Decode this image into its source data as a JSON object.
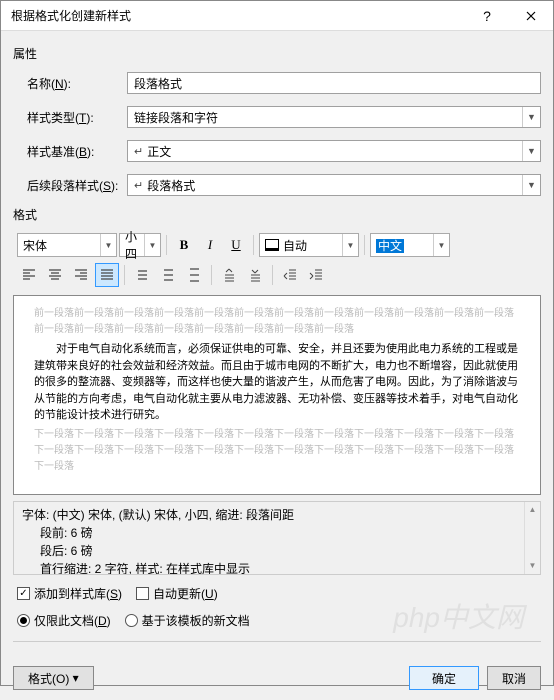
{
  "title": "根据格式化创建新样式",
  "properties_label": "属性",
  "fields": {
    "name_label": "名称(N):",
    "name_value": "段落格式",
    "type_label": "样式类型(T):",
    "type_value": "链接段落和字符",
    "based_label": "样式基准(B):",
    "based_value": "正文",
    "following_label": "后续段落样式(S):",
    "following_value": "段落格式"
  },
  "format_label": "格式",
  "toolbar": {
    "font": "宋体",
    "size": "小四",
    "bold": "B",
    "italic": "I",
    "underline": "U",
    "color": "自动",
    "lang": "中文"
  },
  "preview": {
    "before": "前一段落前一段落前一段落前一段落前一段落前一段落前一段落前一段落前一段落前一段落前一段落前一段落前一段落前一段落前一段落前一段落前一段落前一段落前一段落前一段落",
    "sample": "对于电气自动化系统而言，必须保证供电的可靠、安全，并且还要为使用此电力系统的工程或是建筑带来良好的社会效益和经济效益。而且由于城市电网的不断扩大，电力也不断增容，因此就使用的很多的整流器、变频器等，而这样也使大量的谐波产生，从而危害了电网。因此，为了消除谐波与从节能的方向考虑，电气自动化就主要从电力滤波器、无功补偿、变压器等技术着手，对电气自动化的节能设计技术进行研究。",
    "after": "下一段落下一段落下一段落下一段落下一段落下一段落下一段落下一段落下一段落下一段落下一段落下一段落下一段落下一段落下一段落下一段落下一段落下一段落下一段落下一段落下一段落下一段落下一段落下一段落下一段落"
  },
  "description": {
    "line1": "字体: (中文) 宋体, (默认) 宋体, 小四, 缩进: 段落间距",
    "line2": "段前: 6 磅",
    "line3": "段后: 6 磅",
    "line4": "首行缩进:  2 字符, 样式: 在样式库中显示"
  },
  "checks": {
    "add_gallery": "添加到样式库(S)",
    "auto_update": "自动更新(U)"
  },
  "radios": {
    "this_doc": "仅限此文档(D)",
    "template": "基于该模板的新文档"
  },
  "buttons": {
    "format": "格式(O)",
    "ok": "确定",
    "cancel": "取消"
  },
  "watermark": "php中文网"
}
